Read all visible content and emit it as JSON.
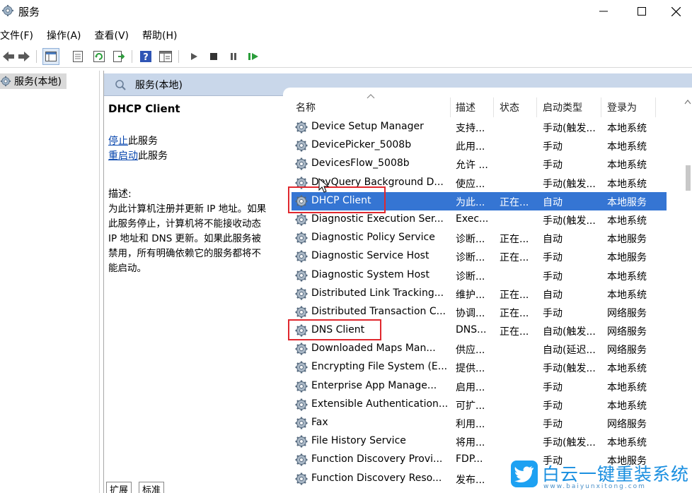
{
  "window": {
    "title": "服务"
  },
  "menu": {
    "file": "文件(F)",
    "action": "操作(A)",
    "view": "查看(V)",
    "help": "帮助(H)"
  },
  "tree": {
    "root": "服务(本地)"
  },
  "panel": {
    "header": "服务(本地)",
    "selected_service": "DHCP Client",
    "stop_link": "停止",
    "stop_suffix": "此服务",
    "restart_link": "重启动",
    "restart_suffix": "此服务",
    "desc_label": "描述:",
    "desc_lines": [
      "为此计算机注册并更新 IP 地址。如果",
      "此服务停止，计算机将不能接收动态",
      "IP 地址和 DNS 更新。如果此服务被",
      "禁用，所有明确依赖它的服务都将不",
      "能启动。"
    ]
  },
  "columns": {
    "name": "名称",
    "description": "描述",
    "status": "状态",
    "startup": "启动类型",
    "logon": "登录为"
  },
  "services": [
    {
      "name": "Device Setup Manager",
      "desc": "支持...",
      "status": "",
      "startup": "手动(触发...",
      "logon": "本地系统"
    },
    {
      "name": "DevicePicker_5008b",
      "desc": "此用...",
      "status": "",
      "startup": "手动",
      "logon": "本地系统"
    },
    {
      "name": "DevicesFlow_5008b",
      "desc": "允许 ...",
      "status": "",
      "startup": "手动",
      "logon": "本地系统"
    },
    {
      "name": "DevQuery Background D...",
      "desc": "使应...",
      "status": "",
      "startup": "手动(触发...",
      "logon": "本地系统"
    },
    {
      "name": "DHCP Client",
      "desc": "为此...",
      "status": "正在...",
      "startup": "自动",
      "logon": "本地服务"
    },
    {
      "name": "Diagnostic Execution Ser...",
      "desc": "Exec...",
      "status": "",
      "startup": "手动(触发...",
      "logon": "本地系统"
    },
    {
      "name": "Diagnostic Policy Service",
      "desc": "诊断...",
      "status": "正在...",
      "startup": "自动",
      "logon": "本地服务"
    },
    {
      "name": "Diagnostic Service Host",
      "desc": "诊断...",
      "status": "正在...",
      "startup": "手动",
      "logon": "本地服务"
    },
    {
      "name": "Diagnostic System Host",
      "desc": "诊断...",
      "status": "",
      "startup": "手动",
      "logon": "本地系统"
    },
    {
      "name": "Distributed Link Tracking...",
      "desc": "维护...",
      "status": "正在...",
      "startup": "自动",
      "logon": "本地系统"
    },
    {
      "name": "Distributed Transaction C...",
      "desc": "协调...",
      "status": "正在...",
      "startup": "手动",
      "logon": "网络服务"
    },
    {
      "name": "DNS Client",
      "desc": "DNS...",
      "status": "正在...",
      "startup": "自动(触发...",
      "logon": "网络服务"
    },
    {
      "name": "Downloaded Maps Man...",
      "desc": "供应...",
      "status": "",
      "startup": "自动(延迟...",
      "logon": "网络服务"
    },
    {
      "name": "Encrypting File System (E...",
      "desc": "提供...",
      "status": "",
      "startup": "手动(触发...",
      "logon": "本地系统"
    },
    {
      "name": "Enterprise App Manage...",
      "desc": "启用...",
      "status": "",
      "startup": "手动",
      "logon": "本地系统"
    },
    {
      "name": "Extensible Authentication...",
      "desc": "可扩...",
      "status": "",
      "startup": "手动",
      "logon": "本地系统"
    },
    {
      "name": "Fax",
      "desc": "利用...",
      "status": "",
      "startup": "手动",
      "logon": "网络服务"
    },
    {
      "name": "File History Service",
      "desc": "将用...",
      "status": "",
      "startup": "手动(触发...",
      "logon": "本地系统"
    },
    {
      "name": "Function Discovery Provi...",
      "desc": "FDP...",
      "status": "",
      "startup": "手动",
      "logon": "本地服务"
    },
    {
      "name": "Function Discovery Reso...",
      "desc": "发布...",
      "status": "",
      "startup": "",
      "logon": ""
    }
  ],
  "selected_index": 4,
  "tabs": {
    "extended": "扩展",
    "standard": "标准"
  },
  "watermark": {
    "text": "白云一键重装系统",
    "url": "www.baiyunxitong.com"
  },
  "colors": {
    "selection": "#3575d3",
    "panel_header": "#c9d7ea",
    "annotation": "#e0282e",
    "link": "#0645ad"
  }
}
